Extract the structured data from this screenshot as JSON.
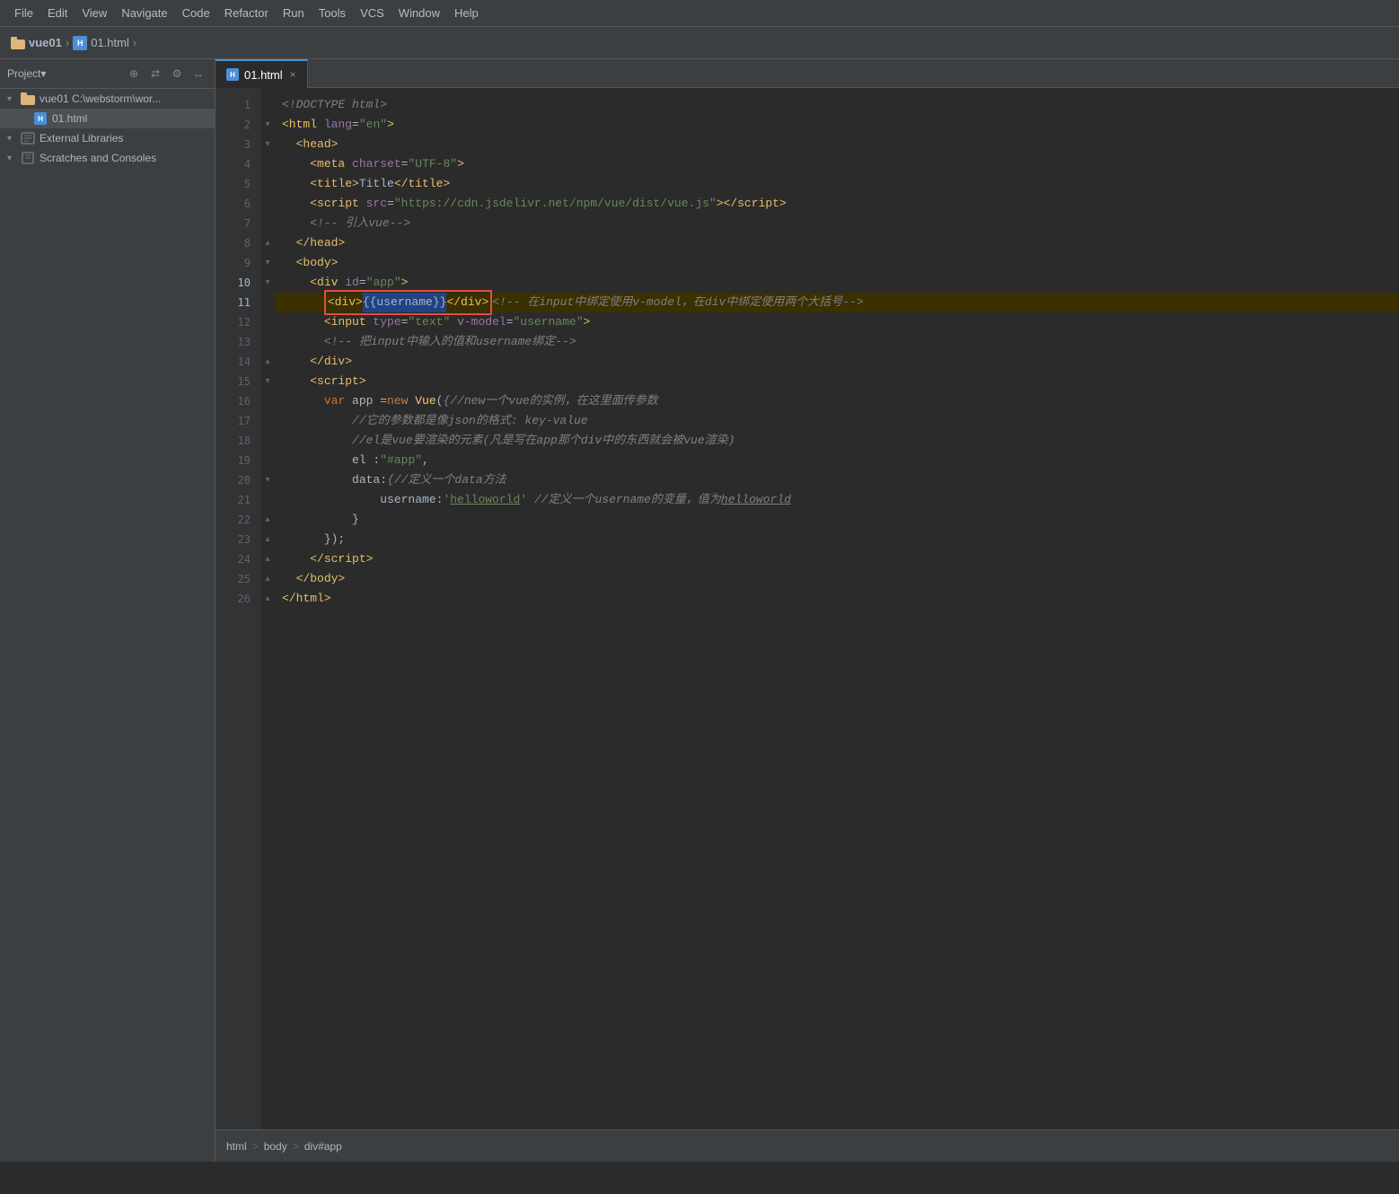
{
  "menubar": {
    "items": [
      "File",
      "Edit",
      "View",
      "Navigate",
      "Code",
      "Refactor",
      "Run",
      "Tools",
      "VCS",
      "Window",
      "Help"
    ]
  },
  "titlebar": {
    "project": "vue01",
    "path": "C:\\webstorm\\wor...",
    "file": "01.html",
    "chevron": "›"
  },
  "sidebar": {
    "title": "Project▾",
    "icons": [
      "⊕",
      "⇄",
      "⚙",
      "↔"
    ],
    "items": [
      {
        "label": "vue01  C:\\webstorm\\wor...",
        "type": "folder",
        "expanded": true,
        "indent": 0
      },
      {
        "label": "01.html",
        "type": "html",
        "indent": 1,
        "selected": true
      },
      {
        "label": "External Libraries",
        "type": "lib",
        "indent": 0
      },
      {
        "label": "Scratches and Consoles",
        "type": "scratch",
        "indent": 0
      }
    ]
  },
  "tab": {
    "label": "01.html",
    "close": "×"
  },
  "code": {
    "lines": [
      {
        "num": 1,
        "fold": "",
        "content": "<!DOCTYPE html>"
      },
      {
        "num": 2,
        "fold": "▾",
        "content": "<html lang=\"en\">"
      },
      {
        "num": 3,
        "fold": "▾",
        "content": "  <head>"
      },
      {
        "num": 4,
        "fold": "",
        "content": "    <meta charset=\"UTF-8\">"
      },
      {
        "num": 5,
        "fold": "",
        "content": "    <title>Title</title>"
      },
      {
        "num": 6,
        "fold": "",
        "content": "    <script src=\"https://cdn.jsdelivr.net/npm/vue/dist/vue.js\"></script>"
      },
      {
        "num": 7,
        "fold": "",
        "content": "    <!-- 引入vue-->"
      },
      {
        "num": 8,
        "fold": "▴",
        "content": "  </head>"
      },
      {
        "num": 9,
        "fold": "▾",
        "content": "  <body>"
      },
      {
        "num": 10,
        "fold": "▾",
        "content": "    <div id=\"app\">"
      },
      {
        "num": 11,
        "fold": "",
        "content": "      <div>{{username}}</div><!-- 在input中绑定使用v-model，在div中绑定使用两个大括号-->"
      },
      {
        "num": 12,
        "fold": "",
        "content": "      <input type=\"text\" v-model=\"username\">"
      },
      {
        "num": 13,
        "fold": "",
        "content": "      <!-- 把input中输入的值和username绑定-->"
      },
      {
        "num": 14,
        "fold": "▴",
        "content": "    </div>"
      },
      {
        "num": 15,
        "fold": "▾",
        "content": "    <script>"
      },
      {
        "num": 16,
        "fold": "",
        "content": "      var app = new Vue({//new一个vue的实例，在这里面传参数"
      },
      {
        "num": 17,
        "fold": "",
        "content": "          //它的参数都是像json的格式: key-value"
      },
      {
        "num": 18,
        "fold": "",
        "content": "          //el是vue要渲染的元素(凡是写在app那个div中的东西就会被vue渲染)"
      },
      {
        "num": 19,
        "fold": "",
        "content": "          el : \"#app\","
      },
      {
        "num": 20,
        "fold": "▾",
        "content": "          data:{//定义一个data方法"
      },
      {
        "num": 21,
        "fold": "",
        "content": "              username:'helloworld' //定义一个username的变量，值为helloworld"
      },
      {
        "num": 22,
        "fold": "▴",
        "content": "          }"
      },
      {
        "num": 23,
        "fold": "▴",
        "content": "      });"
      },
      {
        "num": 24,
        "fold": "▴",
        "content": "    </script>"
      },
      {
        "num": 25,
        "fold": "▴",
        "content": "  </body>"
      },
      {
        "num": 26,
        "fold": "▴",
        "content": "</html>"
      }
    ]
  },
  "statusbar": {
    "breadcrumb": [
      "html",
      "body",
      "div#app"
    ],
    "seps": [
      ">",
      ">"
    ]
  }
}
